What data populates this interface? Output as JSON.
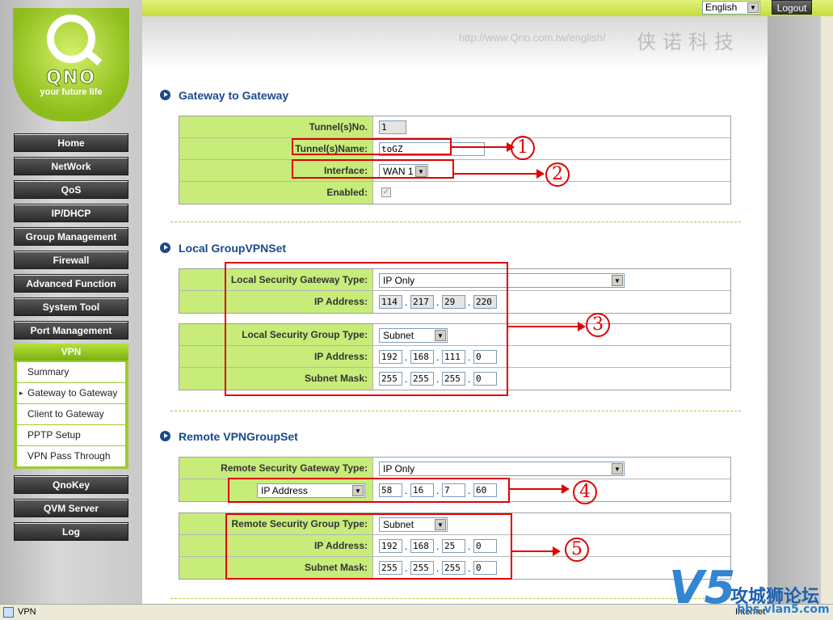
{
  "topbar": {
    "language": "English",
    "logout": "Logout"
  },
  "logo": {
    "brand": "QNO",
    "slogan": "your future life"
  },
  "header": {
    "url": "http://www.Qno.com.tw/english/",
    "cn": "侠诺科技"
  },
  "nav": [
    "Home",
    "NetWork",
    "QoS",
    "IP/DHCP",
    "Group Management",
    "Firewall",
    "Advanced Function",
    "System Tool",
    "Port Management"
  ],
  "vpn": {
    "label": "VPN",
    "items": [
      "Summary",
      "Gateway to Gateway",
      "Client to Gateway",
      "PPTP Setup",
      "VPN Pass Through"
    ]
  },
  "nav_bottom": [
    "QnoKey",
    "QVM Server",
    "Log"
  ],
  "gateway": {
    "title": "Gateway to Gateway",
    "tunnel_no_label": "Tunnel(s)No.",
    "tunnel_no": "1",
    "tunnel_name_label": "Tunnel(s)Name:",
    "tunnel_name": "toGZ",
    "interface_label": "Interface:",
    "interface": "WAN 1",
    "enabled_label": "Enabled:",
    "enabled_mark": "✓"
  },
  "local": {
    "title": "Local GroupVPNSet",
    "gw_type_label": "Local Security Gateway Type:",
    "gw_type": "IP Only",
    "ip_label": "IP Address:",
    "ip": [
      "114",
      "217",
      "29",
      "220"
    ],
    "group_type_label": "Local Security Group Type:",
    "group_type": "Subnet",
    "group_ip_label": "IP Address:",
    "group_ip": [
      "192",
      "168",
      "111",
      "0"
    ],
    "mask_label": "Subnet Mask:",
    "mask": [
      "255",
      "255",
      "255",
      "0"
    ]
  },
  "remote": {
    "title": "Remote VPNGroupSet",
    "gw_type_label": "Remote Security Gateway Type:",
    "gw_type": "IP Only",
    "addr_type": "IP Address",
    "ip": [
      "58",
      "16",
      "7",
      "60"
    ],
    "group_type_label": "Remote Security Group Type:",
    "group_type": "Subnet",
    "group_ip_label": "IP Address:",
    "group_ip": [
      "192",
      "168",
      "25",
      "0"
    ],
    "mask_label": "Subnet Mask:",
    "mask": [
      "255",
      "255",
      "255",
      "0"
    ]
  },
  "annotations": [
    "1",
    "2",
    "3",
    "4",
    "5"
  ],
  "status": {
    "text": "VPN",
    "zone": "Internet"
  },
  "watermark": {
    "v": "V5",
    "cn": "攻城狮论坛",
    "url": "bbs.vlan5.com"
  },
  "colors": {
    "accent": "#1a4a8a",
    "label_bg": "#c8ec7a",
    "annotation": "#e00000"
  }
}
